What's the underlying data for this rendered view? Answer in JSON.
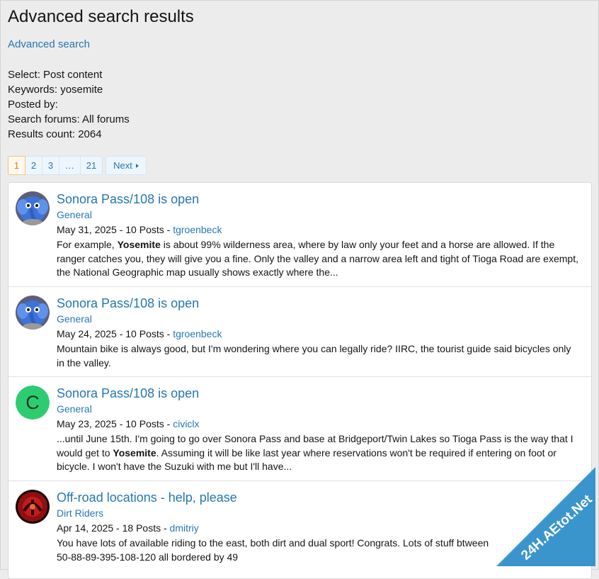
{
  "page": {
    "title": "Advanced search results",
    "advanced_search_link": "Advanced search"
  },
  "criteria": {
    "select": "Select: Post content",
    "keywords": "Keywords: yosemite",
    "posted_by": "Posted by:",
    "forums": "Search forums: All forums",
    "count": "Results count: 2064"
  },
  "pagination": {
    "pages": [
      "1",
      "2",
      "3",
      "…",
      "21"
    ],
    "current": "1",
    "next_label": "Next"
  },
  "results": [
    {
      "title": "Sonora Pass/108 is open",
      "forum": "General",
      "meta_prefix": "May 31, 2025 - 10 Posts - ",
      "user": "tgroenbeck",
      "avatar": "elephant-avatar",
      "snippet_lines": [
        {
          "pre": "For example, ",
          "bold": "Yosemite",
          "post": " is about 99% wilderness area, where by law only your feet and a horse are allowed. If the"
        },
        {
          "pre": "ranger catches you, they will give you a fine. Only the valley and a narrow area left and tight of Tioga Road are exempt,",
          "bold": "",
          "post": ""
        },
        {
          "pre": "the National Geographic map usually shows exactly where the...",
          "bold": "",
          "post": ""
        }
      ]
    },
    {
      "title": "Sonora Pass/108 is open",
      "forum": "General",
      "meta_prefix": "May 24, 2025 - 10 Posts - ",
      "user": "tgroenbeck",
      "avatar": "elephant-avatar",
      "snippet_lines": [
        {
          "pre": "Mountain bike is always good, but I'm wondering where you can legally ride? IIRC, the tourist guide said bicycles only",
          "bold": "",
          "post": ""
        },
        {
          "pre": "in the valley.",
          "bold": "",
          "post": ""
        }
      ]
    },
    {
      "title": "Sonora Pass/108 is open",
      "forum": "General",
      "meta_prefix": "May 23, 2025 - 10 Posts - ",
      "user": "civiclx",
      "avatar": "letter-avatar",
      "avatar_letter": "C",
      "avatar_color": "#2ecc71",
      "snippet_lines": [
        {
          "pre": "...until June 15th. I'm going to go over Sonora Pass and base at Bridgeport/Twin Lakes so Tioga Pass is the way that I",
          "bold": "",
          "post": ""
        },
        {
          "pre": "would get to ",
          "bold": "Yosemite",
          "post": ". Assuming it will be like last year where reservations won't be required if entering on foot or"
        },
        {
          "pre": "bicycle. I won't have the Suzuki with me but I'll have...",
          "bold": "",
          "post": ""
        }
      ]
    },
    {
      "title": "Off-road locations - help, please",
      "forum": "Dirt Riders",
      "meta_prefix": "Apr 14, 2025 - 18 Posts - ",
      "user": "dmitriy",
      "avatar": "red-emblem-avatar",
      "snippet_lines": [
        {
          "pre": "You have lots of available riding to the east, both dirt and dual sport! Congrats. Lots of stuff btween",
          "bold": "",
          "post": ""
        },
        {
          "pre": "50-88-89-395-108-120 all bordered by 49",
          "bold": "",
          "post": ""
        }
      ]
    }
  ],
  "watermark": {
    "text": "24H.AEtot.Net"
  },
  "colors": {
    "link": "#2577b1",
    "page_bg": "#ececec",
    "current_page": "#d6800f",
    "letter_avatar": "#2ecc71",
    "watermark": "#2f8fc9"
  }
}
